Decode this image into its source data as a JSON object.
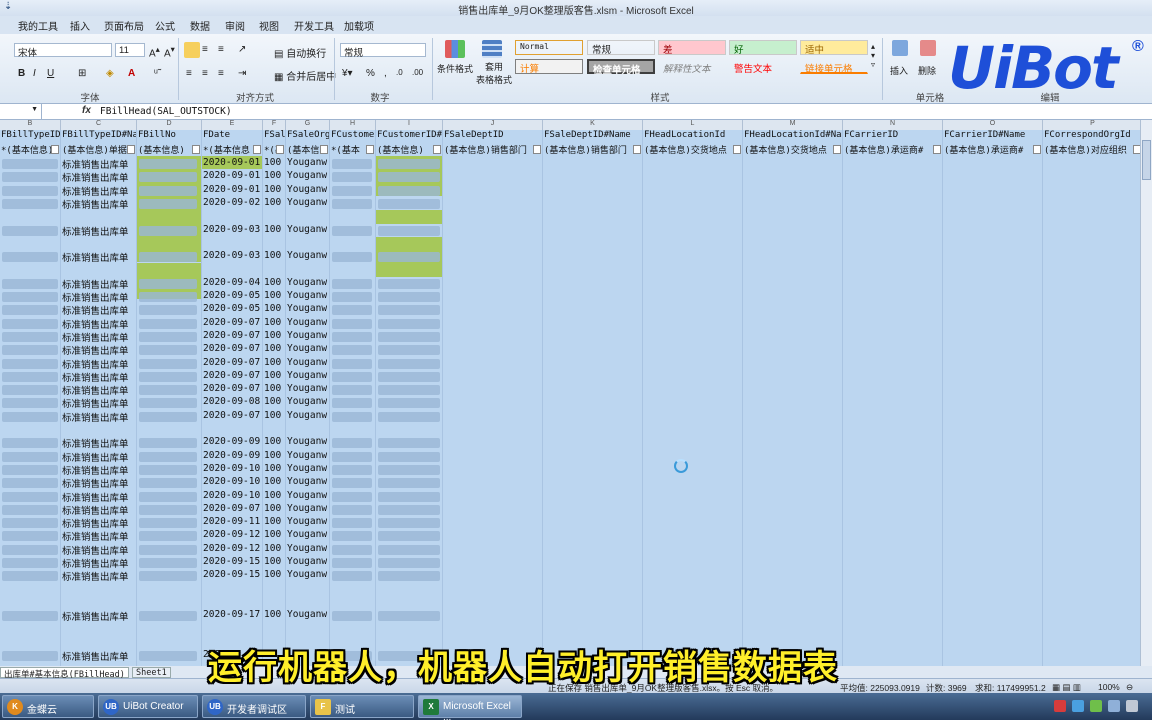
{
  "window": {
    "title": "销售出库单_9月OK整理版客售.xlsm - Microsoft Excel"
  },
  "ribbon_tabs": [
    "我的工具",
    "插入",
    "页面布局",
    "公式",
    "数据",
    "审阅",
    "视图",
    "开发工具",
    "加载项"
  ],
  "ribbon": {
    "font_name": "宋体",
    "font_size": "11",
    "wrap_text": "自动换行",
    "merge_center": "合并后居中",
    "number_format": "常规",
    "cond_format": "条件格式",
    "table_format": "套用\n表格格式",
    "insert": "插入",
    "delete": "删除",
    "groups": {
      "font": "字体",
      "align": "对齐方式",
      "number": "数字",
      "styles": "样式",
      "cells": "单元格",
      "edit": "编辑"
    },
    "styles": [
      {
        "label": "Normal",
        "bg": "#ffffff",
        "fg": "#000000"
      },
      {
        "label": "常规",
        "bg": "#ffffff",
        "fg": "#000000"
      },
      {
        "label": "差",
        "bg": "#ffc7ce",
        "fg": "#9c0006"
      },
      {
        "label": "好",
        "bg": "#c6efce",
        "fg": "#006100"
      },
      {
        "label": "适中",
        "bg": "#ffeb9c",
        "fg": "#9c6500"
      },
      {
        "label": "计算",
        "bg": "#f2f2f2",
        "fg": "#fa7d00"
      },
      {
        "label": "检查单元格",
        "bg": "#a5a5a5",
        "fg": "#ffffff"
      },
      {
        "label": "解释性文本",
        "bg": "#ffffff",
        "fg": "#7f7f7f"
      },
      {
        "label": "警告文本",
        "bg": "#ffffff",
        "fg": "#ff0000"
      },
      {
        "label": "链接单元格",
        "bg": "#ffffff",
        "fg": "#fa7d00"
      }
    ]
  },
  "logo": {
    "text": "UiBot",
    "mark": "®",
    "color": "#1e4fd8"
  },
  "formula_bar": {
    "fx": "fx",
    "content": "FBillHead(SAL_OUTSTOCK)"
  },
  "columns": [
    {
      "letter": "B",
      "h1": "FBillTypeID",
      "h2": "*(基本信息)"
    },
    {
      "letter": "C",
      "h1": "FBillTypeID#Name",
      "h2": "(基本信息)单据"
    },
    {
      "letter": "D",
      "h1": "FBillNo",
      "h2": "(基本信息)"
    },
    {
      "letter": "E",
      "h1": "FDate",
      "h2": "*(基本信息"
    },
    {
      "letter": "F",
      "h1": "FSal",
      "h2": "*(基"
    },
    {
      "letter": "G",
      "h1": "FSaleOrg",
      "h2": "(基本信"
    },
    {
      "letter": "H",
      "h1": "FCustome",
      "h2": "*(基本"
    },
    {
      "letter": "I",
      "h1": "FCustomerID#",
      "h2": "(基本信息)"
    },
    {
      "letter": "J",
      "h1": "FSaleDeptID",
      "h2": "(基本信息)销售部门"
    },
    {
      "letter": "K",
      "h1": "FSaleDeptID#Name",
      "h2": "(基本信息)销售部门"
    },
    {
      "letter": "L",
      "h1": "FHeadLocationId",
      "h2": "(基本信息)交货地点"
    },
    {
      "letter": "M",
      "h1": "FHeadLocationId#Nam",
      "h2": "(基本信息)交货地点"
    },
    {
      "letter": "N",
      "h1": "FCarrierID",
      "h2": "(基本信息)承运商#"
    },
    {
      "letter": "O",
      "h1": "FCarrierID#Name",
      "h2": "(基本信息)承运商#"
    },
    {
      "letter": "P",
      "h1": "FCorrespondOrgId",
      "h2": "(基本信息)对应组织"
    },
    {
      "letter": "Q",
      "h1": "FC",
      "h2": "(基"
    }
  ],
  "rows": [
    {
      "type": "标准销售出库单",
      "date": "2020-09-01",
      "f": "100",
      "org": "Youganw"
    },
    {
      "type": "标准销售出库单",
      "date": "2020-09-01",
      "f": "100",
      "org": "Youganw"
    },
    {
      "type": "标准销售出库单",
      "date": "2020-09-01",
      "f": "100",
      "org": "Youganw"
    },
    {
      "type": "标准销售出库单",
      "date": "2020-09-02",
      "f": "100",
      "org": "Youganw"
    },
    {
      "type": "",
      "date": "",
      "f": "",
      "org": ""
    },
    {
      "type": "标准销售出库单",
      "date": "2020-09-03",
      "f": "100",
      "org": "Youganw"
    },
    {
      "type": "",
      "date": "",
      "f": "",
      "org": ""
    },
    {
      "type": "标准销售出库单",
      "date": "2020-09-03",
      "f": "100",
      "org": "Youganw"
    },
    {
      "type": "",
      "date": "",
      "f": "",
      "org": ""
    },
    {
      "type": "标准销售出库单",
      "date": "2020-09-04",
      "f": "100",
      "org": "Youganw"
    },
    {
      "type": "标准销售出库单",
      "date": "2020-09-05",
      "f": "100",
      "org": "Youganw"
    },
    {
      "type": "标准销售出库单",
      "date": "2020-09-05",
      "f": "100",
      "org": "Youganw"
    },
    {
      "type": "标准销售出库单",
      "date": "2020-09-07",
      "f": "100",
      "org": "Youganw"
    },
    {
      "type": "标准销售出库单",
      "date": "2020-09-07",
      "f": "100",
      "org": "Youganw"
    },
    {
      "type": "标准销售出库单",
      "date": "2020-09-07",
      "f": "100",
      "org": "Youganw"
    },
    {
      "type": "标准销售出库单",
      "date": "2020-09-07",
      "f": "100",
      "org": "Youganw"
    },
    {
      "type": "标准销售出库单",
      "date": "2020-09-07",
      "f": "100",
      "org": "Youganw"
    },
    {
      "type": "标准销售出库单",
      "date": "2020-09-07",
      "f": "100",
      "org": "Youganw"
    },
    {
      "type": "标准销售出库单",
      "date": "2020-09-08",
      "f": "100",
      "org": "Youganw"
    },
    {
      "type": "标准销售出库单",
      "date": "2020-09-07",
      "f": "100",
      "org": "Youganw"
    },
    {
      "type": "",
      "date": "",
      "f": "",
      "org": ""
    },
    {
      "type": "标准销售出库单",
      "date": "2020-09-09",
      "f": "100",
      "org": "Youganw"
    },
    {
      "type": "标准销售出库单",
      "date": "2020-09-09",
      "f": "100",
      "org": "Youganw"
    },
    {
      "type": "标准销售出库单",
      "date": "2020-09-10",
      "f": "100",
      "org": "Youganw"
    },
    {
      "type": "标准销售出库单",
      "date": "2020-09-10",
      "f": "100",
      "org": "Youganw"
    },
    {
      "type": "标准销售出库单",
      "date": "2020-09-10",
      "f": "100",
      "org": "Youganw"
    },
    {
      "type": "标准销售出库单",
      "date": "2020-09-07",
      "f": "100",
      "org": "Youganw"
    },
    {
      "type": "标准销售出库单",
      "date": "2020-09-11",
      "f": "100",
      "org": "Youganw"
    },
    {
      "type": "标准销售出库单",
      "date": "2020-09-12",
      "f": "100",
      "org": "Youganw"
    },
    {
      "type": "标准销售出库单",
      "date": "2020-09-12",
      "f": "100",
      "org": "Youganw"
    },
    {
      "type": "标准销售出库单",
      "date": "2020-09-15",
      "f": "100",
      "org": "Youganw"
    },
    {
      "type": "标准销售出库单",
      "date": "2020-09-15",
      "f": "100",
      "org": "Youganw"
    },
    {
      "type": "",
      "date": "",
      "f": "",
      "org": ""
    },
    {
      "type": "",
      "date": "",
      "f": "",
      "org": ""
    },
    {
      "type": "标准销售出库单",
      "date": "2020-09-17",
      "f": "100",
      "org": "Youganw"
    },
    {
      "type": "",
      "date": "",
      "f": "",
      "org": ""
    },
    {
      "type": "",
      "date": "",
      "f": "",
      "org": ""
    },
    {
      "type": "标准销售出库单",
      "date": "2020",
      "f": "",
      "org": ""
    }
  ],
  "sheets": [
    "出库单#基本信息(FBillHead)",
    "Sheet1"
  ],
  "status": {
    "left": "正在保存 销售出库单_9月OK整理版客售.xlsx。按 Esc 取消。",
    "average": "平均值: 225093.0919",
    "count": "计数: 3969",
    "sum": "求和: 117499951.2",
    "zoom": "100%"
  },
  "subtitle": "运行机器人，机器人自动打开销售数据表",
  "taskbar": [
    {
      "label": "金蝶云",
      "icon": "K"
    },
    {
      "label": "UiBot Creator",
      "icon": "UB"
    },
    {
      "label": "开发者调试区",
      "icon": "UB"
    },
    {
      "label": "测试",
      "icon": "F"
    },
    {
      "label": "Microsoft Excel ...",
      "icon": "X"
    }
  ]
}
